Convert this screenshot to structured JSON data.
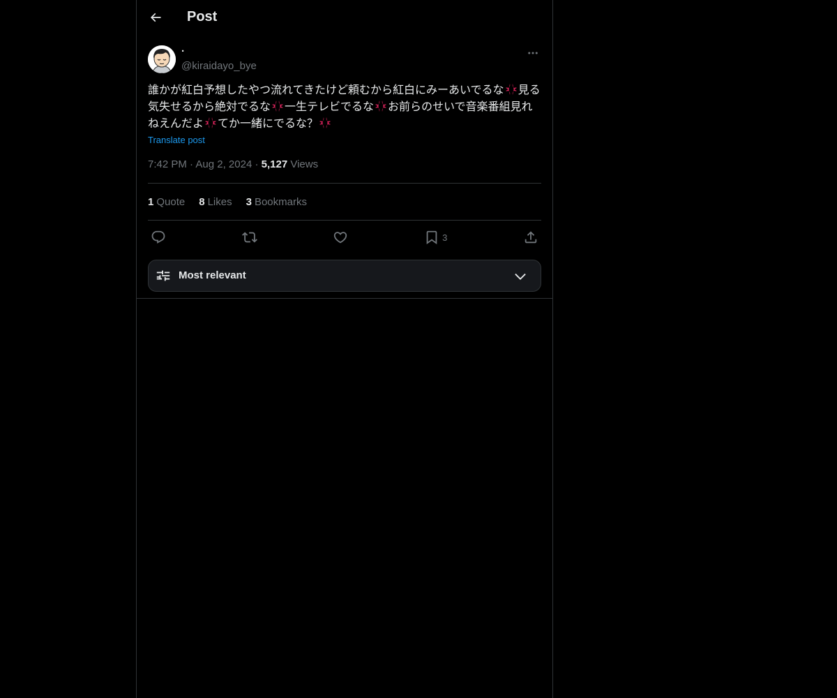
{
  "header": {
    "title": "Post"
  },
  "author": {
    "display_name": "·",
    "handle": "@kiraidayo_bye"
  },
  "post": {
    "text_segments": [
      "誰かが紅白予想したやつ流れてきたけど頼むから紅白にみーあいでるな",
      "見る気失せるから絶対でるな",
      "一生テレビでるな",
      "お前らのせいで音楽番組見れねえんだよ",
      "てか一緒にでるな？"
    ],
    "translate_label": "Translate post",
    "time": "7:42 PM",
    "date": "Aug 2, 2024",
    "views_count": "5,127",
    "views_label": "Views"
  },
  "stats": {
    "quotes_count": "1",
    "quotes_label": "Quote",
    "likes_count": "8",
    "likes_label": "Likes",
    "bookmarks_count": "3",
    "bookmarks_label": "Bookmarks"
  },
  "actions": {
    "bookmark_count": "3"
  },
  "sort": {
    "label": "Most relevant"
  },
  "colors": {
    "background": "#000000",
    "text_primary": "#e7e9ea",
    "text_secondary": "#71767b",
    "link": "#1d9bf0",
    "border": "#2f3336",
    "anger_symbol": "#e0245e"
  },
  "icons": {
    "back": "arrow-left-icon",
    "more": "more-horizontal-icon",
    "reply": "reply-icon",
    "repost": "repost-icon",
    "like": "heart-icon",
    "bookmark": "bookmark-icon",
    "share": "share-icon",
    "sort": "sliders-icon",
    "chevron": "chevron-down-icon",
    "emoji": "anger-symbol-icon"
  }
}
